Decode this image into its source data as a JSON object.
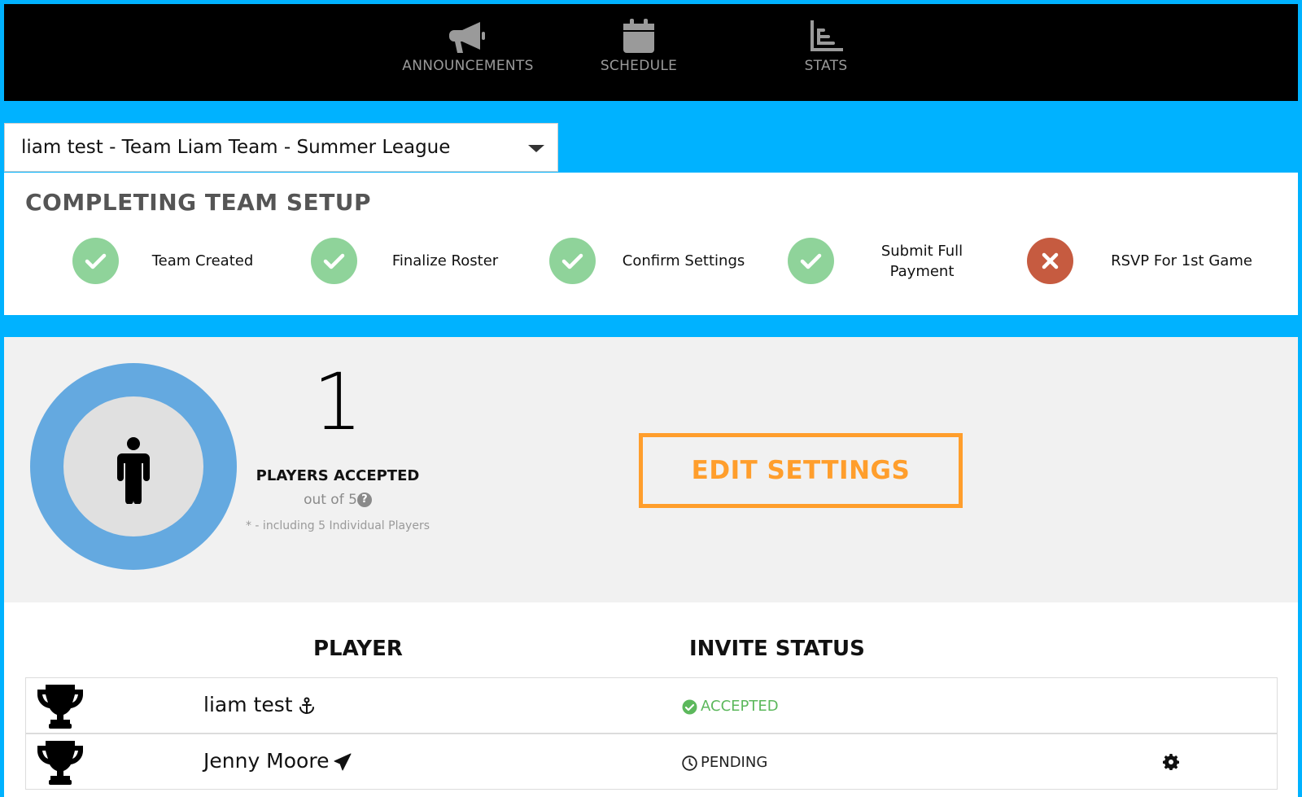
{
  "nav": {
    "items": [
      {
        "label": "ANNOUNCEMENTS",
        "icon": "megaphone-icon"
      },
      {
        "label": "SCHEDULE",
        "icon": "calendar-icon"
      },
      {
        "label": "STATS",
        "icon": "bar-chart-icon"
      }
    ]
  },
  "team_select": {
    "value": "liam test - Team Liam Team - Summer League"
  },
  "setup": {
    "title": "COMPLETING TEAM SETUP",
    "steps": [
      {
        "label": "Team Created",
        "status": "complete"
      },
      {
        "label": "Finalize Roster",
        "status": "complete"
      },
      {
        "label": "Confirm Settings",
        "status": "complete"
      },
      {
        "label": "Submit Full Payment",
        "status": "complete"
      },
      {
        "label": "RSVP For 1st Game",
        "status": "incomplete"
      }
    ]
  },
  "summary": {
    "accepted_count": "1",
    "accepted_label": "PLAYERS ACCEPTED",
    "out_of": "out of 5",
    "help_glyph": "?",
    "note": "* - including 5 Individual Players",
    "edit_button": "EDIT SETTINGS"
  },
  "roster": {
    "headers": {
      "player": "PLAYER",
      "invite_status": "INVITE STATUS"
    },
    "rows": [
      {
        "name": "liam test",
        "name_icon": "anchor-icon",
        "status": "ACCEPTED",
        "status_icon": "check-circle-icon",
        "status_color": "#5cb85c"
      },
      {
        "name": "Jenny Moore",
        "name_icon": "paper-plane-icon",
        "status": "PENDING",
        "status_icon": "clock-icon",
        "status_color": "#222222"
      }
    ]
  },
  "colors": {
    "page_bg": "#00b2ff",
    "nav_bg": "#000000",
    "accent_orange": "#ff9e2c",
    "step_complete": "#8fd39a",
    "step_incomplete": "#c65b40",
    "ring": "#64a9e0"
  }
}
